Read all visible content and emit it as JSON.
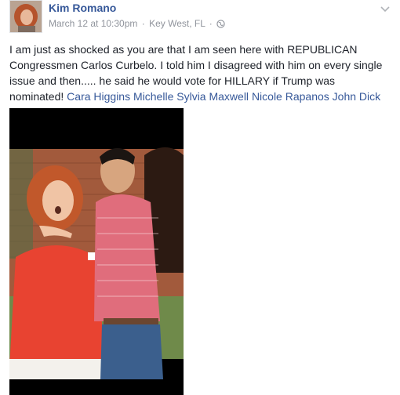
{
  "post": {
    "author": "Kim Romano",
    "timestamp": "March 12 at 10:30pm",
    "separator": "·",
    "location": "Key West, FL",
    "privacy_icon": "globe-icon",
    "menu_icon": "chevron-down-icon",
    "text": "I am just as shocked as you are that I am seen here with REPUBLICAN Congressmen Carlos Curbelo. I told him I disagreed with him on every single issue and then..... he said he would vote for HILLARY if Trump was nominated!",
    "tags": [
      "Cara Higgins",
      "Michelle Sylvia Maxwell",
      "Nicole Rapanos",
      "John Dick"
    ]
  },
  "colors": {
    "link": "#365899",
    "meta": "#90949c",
    "text": "#1d2129"
  }
}
